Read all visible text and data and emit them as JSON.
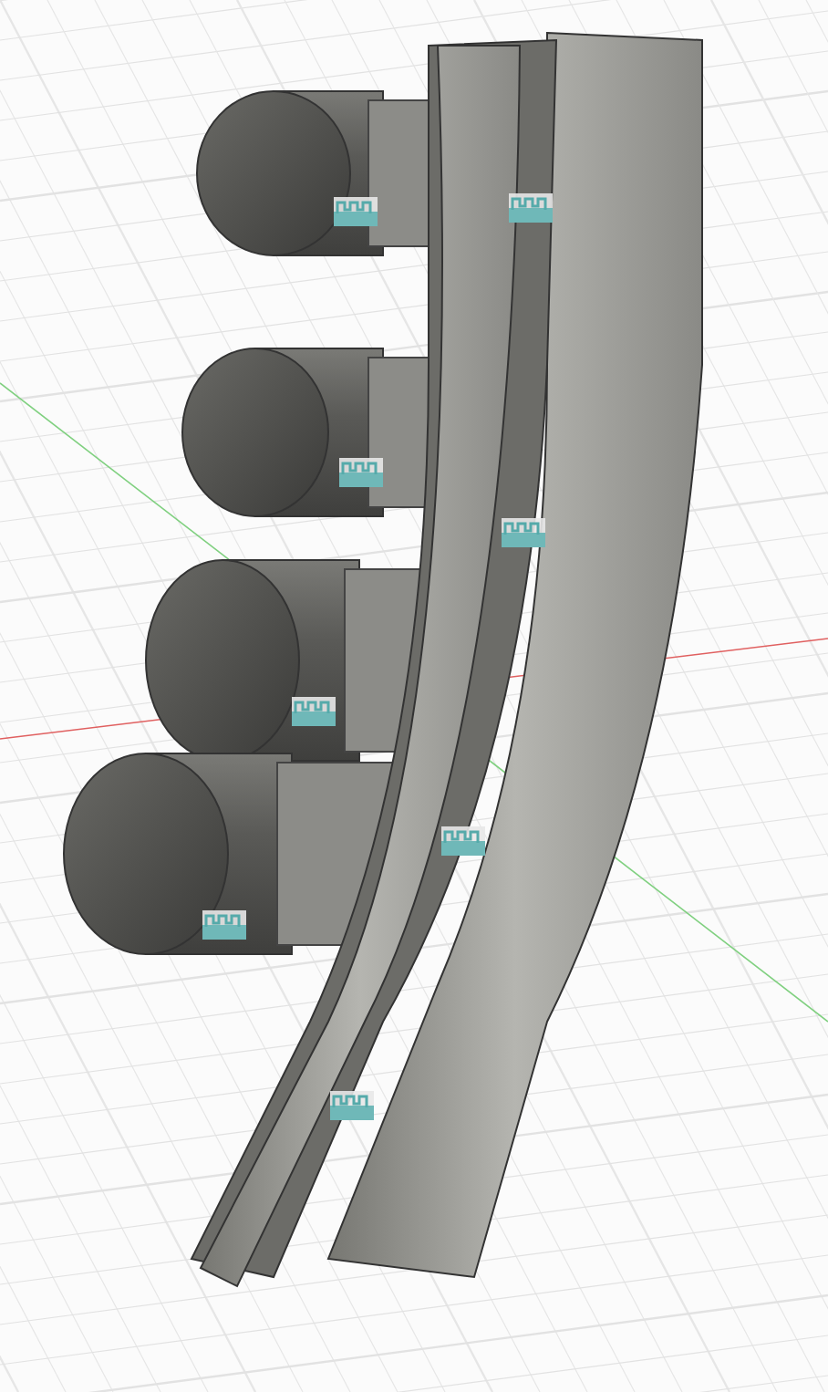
{
  "viewport": {
    "show_grid": true,
    "show_axes": true,
    "joint_markers": [
      {
        "kind": "rigid"
      },
      {
        "kind": "rigid"
      },
      {
        "kind": "rigid"
      },
      {
        "kind": "rigid"
      },
      {
        "kind": "rigid"
      },
      {
        "kind": "rigid"
      },
      {
        "kind": "rigid"
      },
      {
        "kind": "rigid"
      }
    ]
  }
}
